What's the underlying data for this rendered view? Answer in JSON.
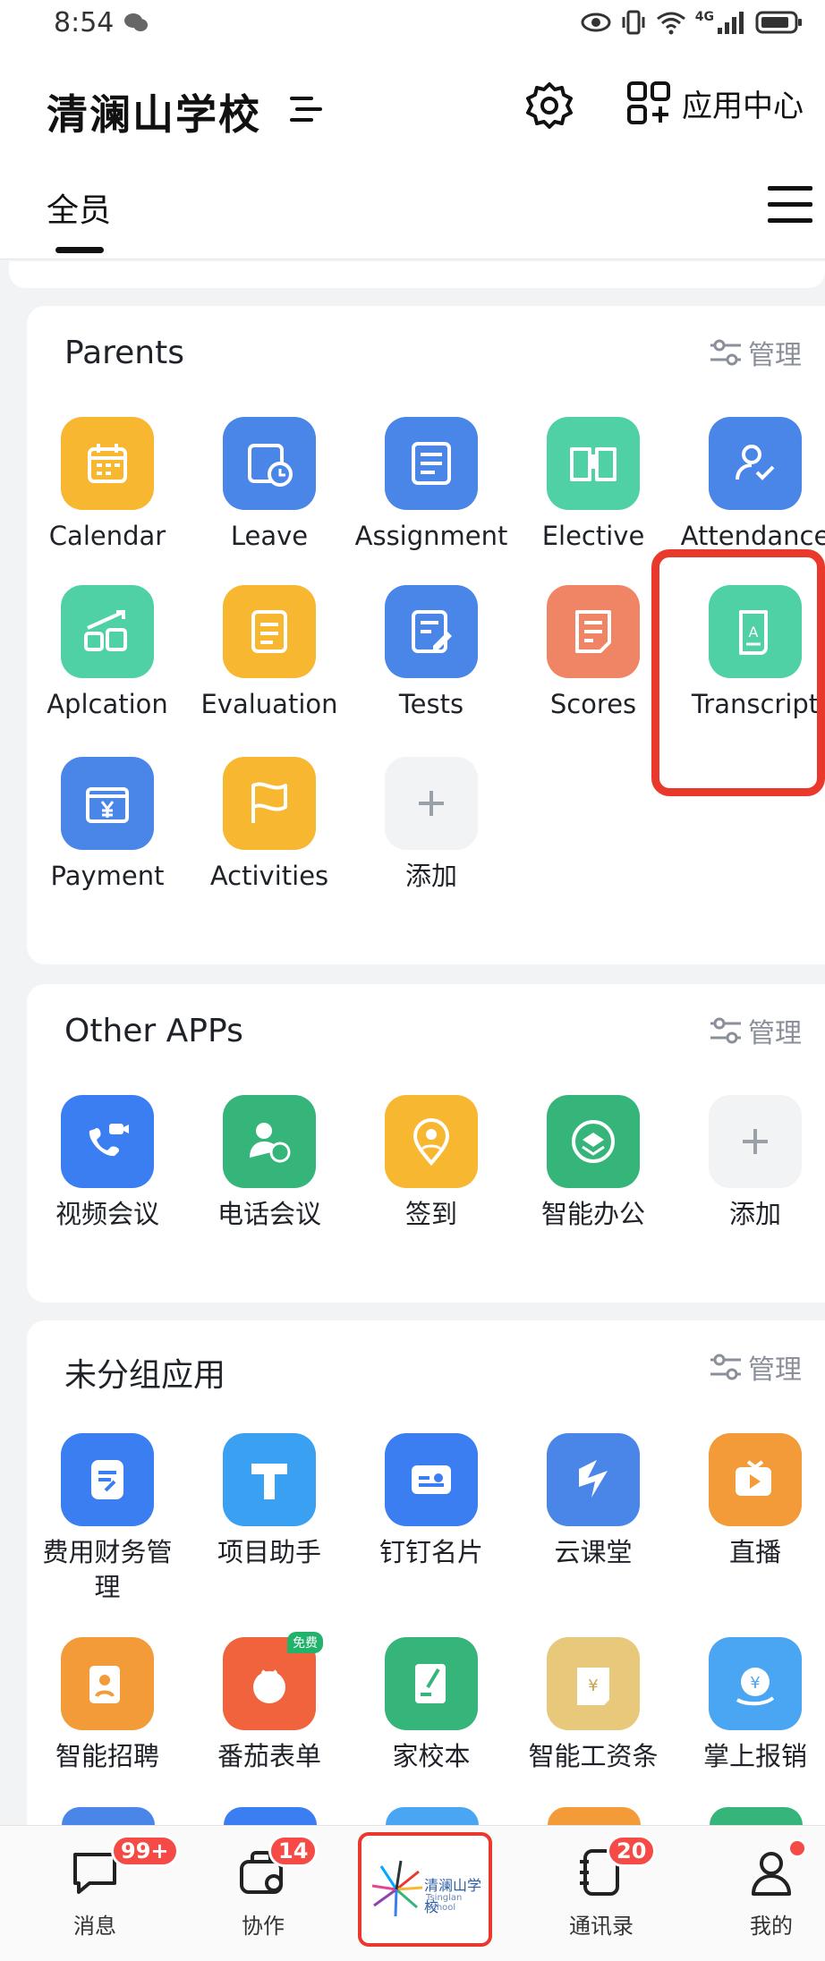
{
  "status_bar": {
    "time": "8:54",
    "signal_label": "4G"
  },
  "header": {
    "title": "清澜山学校",
    "app_center_label": "应用中心"
  },
  "tabs": {
    "all_label": "全员"
  },
  "colors": {
    "highlight": "#e8392c",
    "badge": "#f54a45"
  },
  "sections": [
    {
      "title": "Parents",
      "manage_label": "管理",
      "apps": [
        {
          "label": "Calendar",
          "icon": "calendar-icon",
          "color": "#f7b731"
        },
        {
          "label": "Leave",
          "icon": "leave-clock-icon",
          "color": "#4a86e8"
        },
        {
          "label": "Assignment",
          "icon": "assignment-icon",
          "color": "#4a86e8"
        },
        {
          "label": "Elective",
          "icon": "open-book-icon",
          "color": "#4fd1a5"
        },
        {
          "label": "Attendance",
          "icon": "person-check-icon",
          "color": "#4a86e8"
        },
        {
          "label": "Aplcation",
          "icon": "growth-chart-icon",
          "color": "#4fd1a5"
        },
        {
          "label": "Evaluation",
          "icon": "notepad-icon",
          "color": "#f7b731"
        },
        {
          "label": "Tests",
          "icon": "edit-document-icon",
          "color": "#4a86e8"
        },
        {
          "label": "Scores",
          "icon": "score-document-icon",
          "color": "#f08565"
        },
        {
          "label": "Transcript",
          "icon": "scroll-icon",
          "color": "#4fd1a5"
        },
        {
          "label": "Payment",
          "icon": "yen-payment-icon",
          "color": "#4a86e8"
        },
        {
          "label": "Activities",
          "icon": "flag-icon",
          "color": "#f7b731"
        },
        {
          "label": "添加",
          "icon": "plus-icon",
          "color": "#f2f3f5"
        }
      ]
    },
    {
      "title": "Other APPs",
      "manage_label": "管理",
      "apps": [
        {
          "label": "视频会议",
          "icon": "video-call-icon",
          "color": "#3a7ef2"
        },
        {
          "label": "电话会议",
          "icon": "phone-conference-icon",
          "color": "#35b57a"
        },
        {
          "label": "签到",
          "icon": "check-in-location-icon",
          "color": "#f7b731"
        },
        {
          "label": "智能办公",
          "icon": "smart-office-icon",
          "color": "#35b57a"
        },
        {
          "label": "添加",
          "icon": "plus-icon",
          "color": "#f2f3f5"
        }
      ]
    },
    {
      "title": "未分组应用",
      "manage_label": "管理",
      "apps": [
        {
          "label": "费用财务管理",
          "icon": "expense-icon",
          "color": "#3a7ef2"
        },
        {
          "label": "项目助手",
          "icon": "project-icon",
          "color": "#3aa0f2"
        },
        {
          "label": "钉钉名片",
          "icon": "business-card-icon",
          "color": "#3a7ef2"
        },
        {
          "label": "云课堂",
          "icon": "cloud-class-icon",
          "color": "#4a86e8"
        },
        {
          "label": "直播",
          "icon": "live-tv-icon",
          "color": "#f29b38"
        },
        {
          "label": "智能招聘",
          "icon": "recruit-icon",
          "color": "#f29b38"
        },
        {
          "label": "番茄表单",
          "icon": "tomato-icon",
          "color": "#f0633d",
          "badge": "免费"
        },
        {
          "label": "家校本",
          "icon": "home-school-icon",
          "color": "#35b57a"
        },
        {
          "label": "智能工资条",
          "icon": "salary-icon",
          "color": "#e8c87a"
        },
        {
          "label": "掌上报销",
          "icon": "reimburse-icon",
          "color": "#4aa6f2"
        }
      ]
    }
  ],
  "tabbar": {
    "items": [
      {
        "label": "消息",
        "badge": "99+"
      },
      {
        "label": "协作",
        "badge": "14"
      },
      {
        "label": "通讯录",
        "badge": "20"
      },
      {
        "label": "我的"
      }
    ],
    "logo": {
      "name": "清澜山学校",
      "sub": "Tsinglan School"
    }
  }
}
